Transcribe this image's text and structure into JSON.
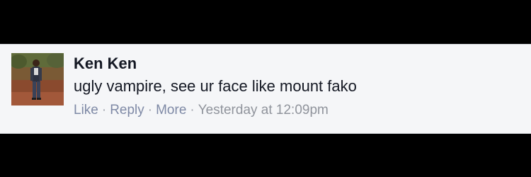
{
  "comment": {
    "author": "Ken Ken",
    "text": "ugly vampire, see ur face like mount fako",
    "actions": {
      "like_label": "Like",
      "reply_label": "Reply",
      "more_label": "More",
      "separator": "·"
    },
    "timestamp": "Yesterday at 12:09pm"
  },
  "colors": {
    "background": "#000000",
    "card_background": "#f5f6f8",
    "author_text": "#141823",
    "action_link": "#7f8aa6",
    "timestamp_text": "#90949c"
  }
}
